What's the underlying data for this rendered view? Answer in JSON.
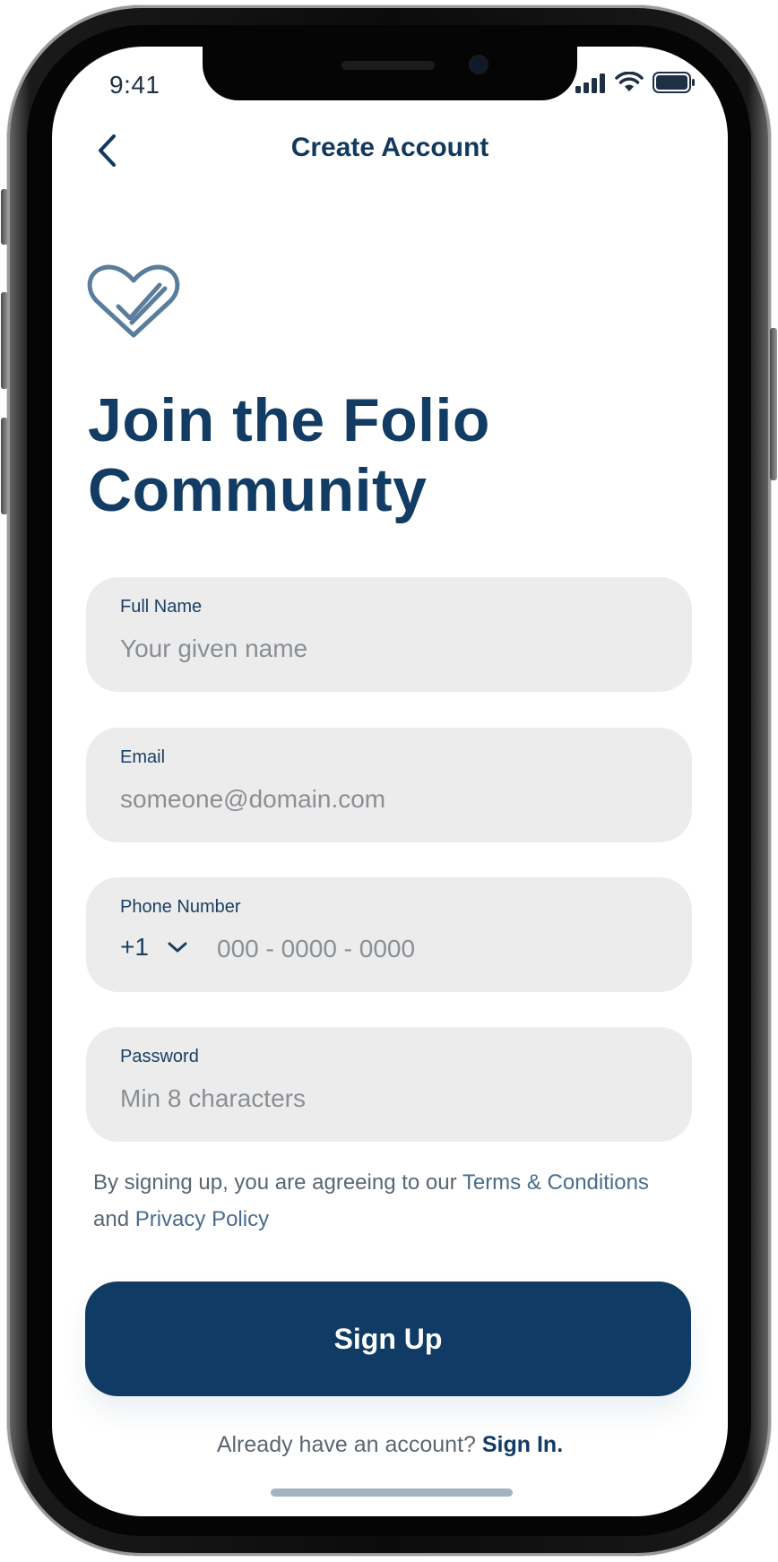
{
  "status_bar": {
    "time": "9:41"
  },
  "nav": {
    "title": "Create Account"
  },
  "headline": {
    "line1": "Join the Folio",
    "line2": "Community"
  },
  "form": {
    "full_name": {
      "label": "Full Name",
      "placeholder": "Your given name"
    },
    "email": {
      "label": "Email",
      "placeholder": "someone@domain.com"
    },
    "phone": {
      "label": "Phone Number",
      "country_code": "+1",
      "placeholder": "000 - 0000 - 0000"
    },
    "password": {
      "label": "Password",
      "placeholder": "Min 8 characters"
    }
  },
  "terms": {
    "prefix": "By signing up, you are agreeing to our ",
    "terms_link": "Terms & Conditions",
    "middle": "and ",
    "privacy_link": "Privacy Policy"
  },
  "signup_button": {
    "label": "Sign Up"
  },
  "signin": {
    "prompt": "Already have an account? ",
    "link": "Sign In."
  },
  "colors": {
    "primary": "#0f3b65",
    "field_bg": "#ececec",
    "link": "#4a6c8c",
    "placeholder": "#8a8f95"
  },
  "icons": [
    "back-chevron-icon",
    "heart-check-logo-icon",
    "chevron-down-icon",
    "cellular-signal-icon",
    "wifi-icon",
    "battery-icon"
  ]
}
